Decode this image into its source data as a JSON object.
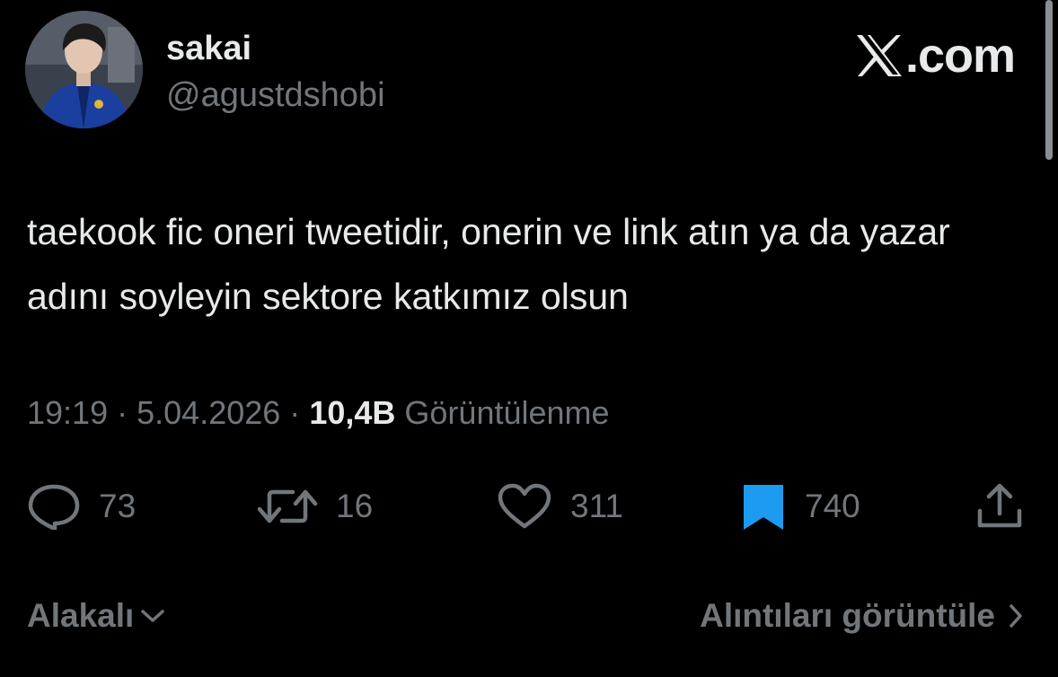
{
  "author": {
    "display_name": "sakai",
    "handle": "@agustdshobi"
  },
  "brand": {
    "text": ".com",
    "logo_icon": "x-logo-icon"
  },
  "tweet": {
    "text": "taekook fic oneri tweetidir, onerin ve link atın ya da yazar adını soyleyin sektore katkımız olsun"
  },
  "meta": {
    "time": "19:19",
    "separator": "·",
    "date": "5.04.2026",
    "views_count": "10,4B",
    "views_label": "Görüntülenme"
  },
  "actions": {
    "replies": {
      "icon": "reply-icon",
      "count": "73"
    },
    "reposts": {
      "icon": "repost-icon",
      "count": "16"
    },
    "likes": {
      "icon": "heart-icon",
      "count": "311"
    },
    "bookmarks": {
      "icon": "bookmark-icon",
      "count": "740",
      "active": true
    },
    "share": {
      "icon": "share-icon"
    }
  },
  "footer": {
    "sort_label": "Alakalı",
    "quotes_label": "Alıntıları görüntüle"
  },
  "colors": {
    "background": "#000000",
    "primary_text": "#e7e9ea",
    "secondary_text": "#71767b",
    "accent_blue": "#1d9bf0"
  }
}
